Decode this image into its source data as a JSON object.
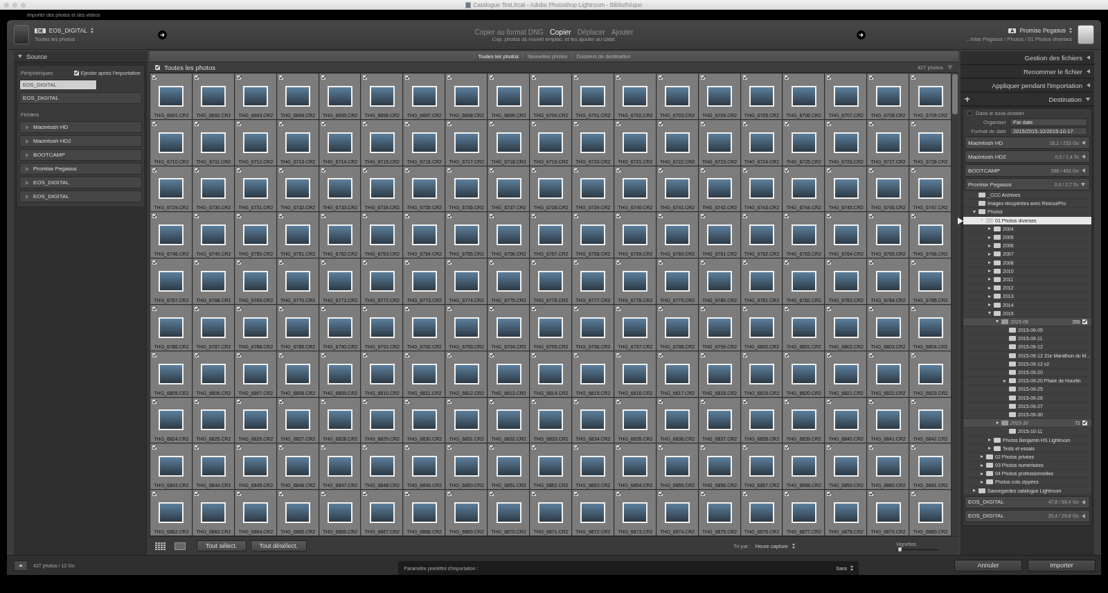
{
  "window": {
    "title": "Catalogue Test.lrcat - Adobe Photoshop Lightroom - Bibliothèque",
    "subtitle": "Importer des photos et des vidéos"
  },
  "source_header": {
    "badge": "DE",
    "device": "EOS_DIGITAL",
    "subtitle": "Toutes les photos"
  },
  "modes": [
    {
      "label": "Copier au format DNG",
      "selected": false
    },
    {
      "label": "Copier",
      "selected": true
    },
    {
      "label": "Déplacer",
      "selected": false
    },
    {
      "label": "Ajouter",
      "selected": false
    }
  ],
  "mode_description": "Cop. photos ds nouvel emplac. et les ajouter au catal.",
  "destination_header": {
    "badge": "A",
    "device": "Promise Pegasus",
    "path": "...mise Pegasus / Photos / 01 Photos diverses"
  },
  "source_panel": {
    "title": "Source",
    "expanded": true,
    "devices_label": "Périphériques",
    "eject": {
      "label": "Ejecter après l'importation",
      "checked": true
    },
    "devices": [
      {
        "name": "EOS_DIGITAL",
        "selected": true
      },
      {
        "name": "EOS_DIGITAL",
        "selected": false
      }
    ],
    "files_label": "Fichiers",
    "volumes": [
      {
        "name": "Macintosh HD",
        "expanded": false
      },
      {
        "name": "Macintosh HD2",
        "expanded": false
      },
      {
        "name": "BOOTCAMP",
        "expanded": false
      },
      {
        "name": "Promise Pegasus",
        "expanded": false
      },
      {
        "name": "EOS_DIGITAL",
        "expanded": false
      },
      {
        "name": "EOS_DIGITAL",
        "expanded": false
      }
    ]
  },
  "view_tabs": [
    {
      "label": "Toutes les photos",
      "selected": true
    },
    {
      "label": "Nouvelles photos",
      "selected": false
    },
    {
      "label": "Dossiers de destination",
      "selected": false
    }
  ],
  "grid_header": {
    "label": "Toutes les photos",
    "checked": true,
    "count": "427 photos"
  },
  "photos": [
    {
      "name": "THG_6691.CR2",
      "checked": true
    },
    {
      "name": "THG_6692.CR2",
      "checked": true
    },
    {
      "name": "THG_6693.CR2",
      "checked": true
    },
    {
      "name": "THG_6694.CR2",
      "checked": true
    },
    {
      "name": "THG_6695.CR2",
      "checked": true
    },
    {
      "name": "THG_6696.CR2",
      "checked": true
    },
    {
      "name": "THG_6697.CR2",
      "checked": true
    },
    {
      "name": "THG_6698.CR2",
      "checked": true
    },
    {
      "name": "THG_6699.CR2",
      "checked": true
    },
    {
      "name": "THG_6700.CR2",
      "checked": true
    },
    {
      "name": "THG_6701.CR2",
      "checked": true
    },
    {
      "name": "THG_6702.CR2",
      "checked": true
    },
    {
      "name": "THG_6703.CR2",
      "checked": true
    },
    {
      "name": "THG_6704.CR2",
      "checked": true
    },
    {
      "name": "THG_6705.CR2",
      "checked": true
    },
    {
      "name": "THG_6706.CR2",
      "checked": true
    },
    {
      "name": "THG_6707.CR2",
      "checked": true
    },
    {
      "name": "THG_6708.CR2",
      "checked": true
    },
    {
      "name": "THG_6709.CR2",
      "checked": true
    },
    {
      "name": "THG_6710.CR2",
      "checked": true
    },
    {
      "name": "THG_6711.CR2",
      "checked": true
    },
    {
      "name": "THG_6712.CR2",
      "checked": true
    },
    {
      "name": "THG_6713.CR2",
      "checked": true
    },
    {
      "name": "THG_6714.CR2",
      "checked": true
    },
    {
      "name": "THG_6715.CR2",
      "checked": true
    },
    {
      "name": "THG_6716.CR2",
      "checked": true
    },
    {
      "name": "THG_6717.CR2",
      "checked": true
    },
    {
      "name": "THG_6718.CR2",
      "checked": true
    },
    {
      "name": "THG_6719.CR2",
      "checked": true
    },
    {
      "name": "THG_6720.CR2",
      "checked": true
    },
    {
      "name": "THG_6721.CR2",
      "checked": true
    },
    {
      "name": "THG_6722.CR2",
      "checked": true
    },
    {
      "name": "THG_6723.CR2",
      "checked": true
    },
    {
      "name": "THG_6724.CR2",
      "checked": true
    },
    {
      "name": "THG_6725.CR2",
      "checked": true
    },
    {
      "name": "THG_6726.CR2",
      "checked": true
    },
    {
      "name": "THG_6727.CR2",
      "checked": true
    },
    {
      "name": "THG_6728.CR2",
      "checked": true
    },
    {
      "name": "THG_6729.CR2",
      "checked": true
    },
    {
      "name": "THG_6730.CR2",
      "checked": true
    },
    {
      "name": "THG_6731.CR2",
      "checked": true
    },
    {
      "name": "THG_6732.CR2",
      "checked": true
    },
    {
      "name": "THG_6733.CR2",
      "checked": true
    },
    {
      "name": "THG_6734.CR2",
      "checked": true
    },
    {
      "name": "THG_6735.CR2",
      "checked": true
    },
    {
      "name": "THG_6736.CR2",
      "checked": true
    },
    {
      "name": "THG_6737.CR2",
      "checked": true
    },
    {
      "name": "THG_6738.CR2",
      "checked": true
    },
    {
      "name": "THG_6739.CR2",
      "checked": true
    },
    {
      "name": "THG_6740.CR2",
      "checked": true
    },
    {
      "name": "THG_6741.CR2",
      "checked": true
    },
    {
      "name": "THG_6742.CR2",
      "checked": true
    },
    {
      "name": "THG_6743.CR2",
      "checked": true
    },
    {
      "name": "THG_6744.CR2",
      "checked": true
    },
    {
      "name": "THG_6745.CR2",
      "checked": true
    },
    {
      "name": "THG_6746.CR2",
      "checked": true
    },
    {
      "name": "THG_6747.CR2",
      "checked": true
    },
    {
      "name": "THG_6748.CR2",
      "checked": true
    },
    {
      "name": "THG_6749.CR2",
      "checked": true
    },
    {
      "name": "THG_6750.CR2",
      "checked": true
    },
    {
      "name": "THG_6751.CR2",
      "checked": true
    },
    {
      "name": "THG_6752.CR2",
      "checked": true
    },
    {
      "name": "THG_6753.CR2",
      "checked": true
    },
    {
      "name": "THG_6754.CR2",
      "checked": true
    },
    {
      "name": "THG_6755.CR2",
      "checked": true
    },
    {
      "name": "THG_6756.CR2",
      "checked": true
    },
    {
      "name": "THG_6757.CR2",
      "checked": true
    },
    {
      "name": "THG_6758.CR2",
      "checked": true
    },
    {
      "name": "THG_6759.CR2",
      "checked": true
    },
    {
      "name": "THG_6760.CR2",
      "checked": true
    },
    {
      "name": "THG_6761.CR2",
      "checked": true
    },
    {
      "name": "THG_6762.CR2",
      "checked": true
    },
    {
      "name": "THG_6763.CR2",
      "checked": true
    },
    {
      "name": "THG_6764.CR2",
      "checked": true
    },
    {
      "name": "THG_6765.CR2",
      "checked": true
    },
    {
      "name": "THG_6766.CR2",
      "checked": true
    },
    {
      "name": "THG_6767.CR2",
      "checked": true
    },
    {
      "name": "THG_6768.CR2",
      "checked": true
    },
    {
      "name": "THG_6769.CR2",
      "checked": true
    },
    {
      "name": "THG_6770.CR2",
      "checked": true
    },
    {
      "name": "THG_6771.CR2",
      "checked": true
    },
    {
      "name": "THG_6772.CR2",
      "checked": true
    },
    {
      "name": "THG_6773.CR2",
      "checked": true
    },
    {
      "name": "THG_6774.CR2",
      "checked": true
    },
    {
      "name": "THG_6775.CR2",
      "checked": true
    },
    {
      "name": "THG_6776.CR2",
      "checked": true
    },
    {
      "name": "THG_6777.CR2",
      "checked": true
    },
    {
      "name": "THG_6778.CR2",
      "checked": true
    },
    {
      "name": "THG_6779.CR2",
      "checked": true
    },
    {
      "name": "THG_6780.CR2",
      "checked": true
    },
    {
      "name": "THG_6781.CR2",
      "checked": true
    },
    {
      "name": "THG_6782.CR2",
      "checked": true
    },
    {
      "name": "THG_6783.CR2",
      "checked": true
    },
    {
      "name": "THG_6784.CR2",
      "checked": true
    },
    {
      "name": "THG_6785.CR2",
      "checked": true
    },
    {
      "name": "THG_6786.CR2",
      "checked": true
    },
    {
      "name": "THG_6787.CR2",
      "checked": true
    },
    {
      "name": "THG_6788.CR2",
      "checked": true
    },
    {
      "name": "THG_6789.CR2",
      "checked": true
    },
    {
      "name": "THG_6790.CR2",
      "checked": true
    },
    {
      "name": "THG_6791.CR2",
      "checked": true
    },
    {
      "name": "THG_6792.CR2",
      "checked": true
    },
    {
      "name": "THG_6793.CR2",
      "checked": true
    },
    {
      "name": "THG_6794.CR2",
      "checked": true
    },
    {
      "name": "THG_6795.CR2",
      "checked": true
    },
    {
      "name": "THG_6796.CR2",
      "checked": true
    },
    {
      "name": "THG_6797.CR2",
      "checked": true
    },
    {
      "name": "THG_6798.CR2",
      "checked": true
    },
    {
      "name": "THG_6799.CR2",
      "checked": true
    },
    {
      "name": "THG_6800.CR2",
      "checked": true
    },
    {
      "name": "THG_6801.CR2",
      "checked": true
    },
    {
      "name": "THG_6802.CR2",
      "checked": true
    },
    {
      "name": "THG_6803.CR2",
      "checked": true
    },
    {
      "name": "THG_6804.CR2",
      "checked": true
    },
    {
      "name": "THG_6805.CR2",
      "checked": true
    },
    {
      "name": "THG_6806.CR2",
      "checked": true
    },
    {
      "name": "THG_6807.CR2",
      "checked": true
    },
    {
      "name": "THG_6808.CR2",
      "checked": true
    },
    {
      "name": "THG_6809.CR2",
      "checked": true
    },
    {
      "name": "THG_6810.CR2",
      "checked": true
    },
    {
      "name": "THG_6811.CR2",
      "checked": true
    },
    {
      "name": "THG_6812.CR2",
      "checked": true
    },
    {
      "name": "THG_6813.CR2",
      "checked": true
    },
    {
      "name": "THG_6814.CR2",
      "checked": true
    },
    {
      "name": "THG_6815.CR2",
      "checked": true
    },
    {
      "name": "THG_6816.CR2",
      "checked": true
    },
    {
      "name": "THG_6817.CR2",
      "checked": true
    },
    {
      "name": "THG_6818.CR2",
      "checked": true
    },
    {
      "name": "THG_6819.CR2",
      "checked": true
    },
    {
      "name": "THG_6820.CR2",
      "checked": true
    },
    {
      "name": "THG_6821.CR2",
      "checked": true
    },
    {
      "name": "THG_6822.CR2",
      "checked": true
    },
    {
      "name": "THG_6823.CR2",
      "checked": true
    },
    {
      "name": "THG_6824.CR2",
      "checked": true
    },
    {
      "name": "THG_6825.CR2",
      "checked": true
    },
    {
      "name": "THG_6826.CR2",
      "checked": true
    },
    {
      "name": "THG_6827.CR2",
      "checked": true
    },
    {
      "name": "THG_6828.CR2",
      "checked": true
    },
    {
      "name": "THG_6829.CR2",
      "checked": true
    },
    {
      "name": "THG_6830.CR2",
      "checked": true
    },
    {
      "name": "THG_6831.CR2",
      "checked": true
    },
    {
      "name": "THG_6832.CR2",
      "checked": true
    },
    {
      "name": "THG_6833.CR2",
      "checked": true
    },
    {
      "name": "THG_6834.CR2",
      "checked": true
    },
    {
      "name": "THG_6835.CR2",
      "checked": true
    },
    {
      "name": "THG_6836.CR2",
      "checked": true
    },
    {
      "name": "THG_6837.CR2",
      "checked": true
    },
    {
      "name": "THG_6838.CR2",
      "checked": true
    },
    {
      "name": "THG_6839.CR2",
      "checked": true
    },
    {
      "name": "THG_6840.CR2",
      "checked": true
    },
    {
      "name": "THG_6841.CR2",
      "checked": true
    },
    {
      "name": "THG_6842.CR2",
      "checked": true
    },
    {
      "name": "THG_6843.CR2",
      "checked": true
    },
    {
      "name": "THG_6844.CR2",
      "checked": true
    },
    {
      "name": "THG_6845.CR2",
      "checked": true
    },
    {
      "name": "THG_6846.CR2",
      "checked": true
    },
    {
      "name": "THG_6847.CR2",
      "checked": true
    },
    {
      "name": "THG_6848.CR2",
      "checked": true
    },
    {
      "name": "THG_6849.CR2",
      "checked": true
    },
    {
      "name": "THG_6850.CR2",
      "checked": true
    },
    {
      "name": "THG_6851.CR2",
      "checked": true
    },
    {
      "name": "THG_6852.CR2",
      "checked": true
    },
    {
      "name": "THG_6853.CR2",
      "checked": true
    },
    {
      "name": "THG_6854.CR2",
      "checked": true
    },
    {
      "name": "THG_6855.CR2",
      "checked": true
    },
    {
      "name": "THG_6856.CR2",
      "checked": true
    },
    {
      "name": "THG_6857.CR2",
      "checked": true
    },
    {
      "name": "THG_6858.CR2",
      "checked": true
    },
    {
      "name": "THG_6859.CR2",
      "checked": true
    },
    {
      "name": "THG_6860.CR2",
      "checked": true
    },
    {
      "name": "THG_6861.CR2",
      "checked": true
    },
    {
      "name": "THG_6862.CR2",
      "checked": true
    },
    {
      "name": "THG_6863.CR2",
      "checked": true
    },
    {
      "name": "THG_6864.CR2",
      "checked": true
    },
    {
      "name": "THG_6865.CR2",
      "checked": true
    },
    {
      "name": "THG_6866.CR2",
      "checked": true
    },
    {
      "name": "THG_6867.CR2",
      "checked": true
    },
    {
      "name": "THG_6868.CR2",
      "checked": true
    },
    {
      "name": "THG_6869.CR2",
      "checked": true
    },
    {
      "name": "THG_6870.CR2",
      "checked": true
    },
    {
      "name": "THG_6871.CR2",
      "checked": true
    },
    {
      "name": "THG_6872.CR2",
      "checked": true
    },
    {
      "name": "THG_6873.CR2",
      "checked": true
    },
    {
      "name": "THG_6874.CR2",
      "checked": true
    },
    {
      "name": "THG_6875.CR2",
      "checked": true
    },
    {
      "name": "THG_6876.CR2",
      "checked": true
    },
    {
      "name": "THG_6877.CR2",
      "checked": true
    },
    {
      "name": "THG_6878.CR2",
      "checked": true
    },
    {
      "name": "THG_6879.CR2",
      "checked": true
    },
    {
      "name": "THG_6880.CR2",
      "checked": true
    }
  ],
  "grid_toolbar": {
    "select_all": "Tout sélect.",
    "deselect_all": "Tout désélect.",
    "sort_label": "Tri par :",
    "sort_value": "Heure capture",
    "thumbs_label": "Vignettes",
    "thumbs_slider": {
      "level": 0.05
    }
  },
  "right_sections": [
    {
      "title": "Gestion des fichiers",
      "expanded": false
    },
    {
      "title": "Renommer le fichier",
      "expanded": false
    },
    {
      "title": "Appliquer pendant l'importation",
      "expanded": false
    },
    {
      "title": "Destination",
      "expanded": true
    }
  ],
  "destination": {
    "subfolder": {
      "label": "Dans le sous-dossier",
      "checked": false
    },
    "organize_label": "Organiser",
    "organize_value": "Par date",
    "date_label": "Format de date",
    "date_value": "2015/2015-10/2015-10-17",
    "volumes": [
      {
        "name": "Macintosh HD",
        "space": "16,2 / 233 Go",
        "expanded": false
      },
      {
        "name": "Macintosh HD2",
        "space": "0,9 / 1,4 To",
        "expanded": false
      },
      {
        "name": "BOOTCAMP",
        "space": "398 / 463 Go",
        "expanded": false
      },
      {
        "name": "Promise Pegasus",
        "space": "0,9 / 2,7 To",
        "expanded": true,
        "children": [
          {
            "name": "_CCC Archives",
            "selected": false
          },
          {
            "name": "Images récupérées avec RescuePro",
            "selected": false
          },
          {
            "name": "Photos",
            "expanded": true,
            "arrow": true,
            "selected": false,
            "children": [
              {
                "name": "01 Photos diverses",
                "expanded": true,
                "arrow": true,
                "selected": true,
                "children": [
                  {
                    "name": "2004",
                    "expanded": false,
                    "arrow": true,
                    "selected": false
                  },
                  {
                    "name": "2005",
                    "expanded": false,
                    "arrow": true,
                    "selected": false
                  },
                  {
                    "name": "2006",
                    "expanded": false,
                    "arrow": true,
                    "selected": false
                  },
                  {
                    "name": "2007",
                    "expanded": false,
                    "arrow": true,
                    "selected": false
                  },
                  {
                    "name": "2008",
                    "expanded": false,
                    "arrow": true,
                    "selected": false
                  },
                  {
                    "name": "2010",
                    "expanded": false,
                    "arrow": true,
                    "selected": false
                  },
                  {
                    "name": "2011",
                    "expanded": false,
                    "arrow": true,
                    "selected": false
                  },
                  {
                    "name": "2012",
                    "expanded": false,
                    "arrow": true,
                    "selected": false
                  },
                  {
                    "name": "2013",
                    "expanded": false,
                    "arrow": true,
                    "selected": false
                  },
                  {
                    "name": "2014",
                    "expanded": false,
                    "arrow": true,
                    "selected": false
                  },
                  {
                    "name": "2015",
                    "expanded": true,
                    "arrow": true,
                    "selected": false,
                    "children": [
                      {
                        "name": "2015-09",
                        "kind": "new",
                        "count": "356",
                        "checked": true,
                        "expanded": true,
                        "arrow": true,
                        "selected": false,
                        "children": [
                          {
                            "name": "2015-09-05",
                            "selected": false
                          },
                          {
                            "name": "2015-09-11",
                            "selected": false
                          },
                          {
                            "name": "2015-09-12",
                            "selected": false
                          },
                          {
                            "name": "2015-09-12 31e Marathon du M...",
                            "selected": false
                          },
                          {
                            "name": "2015-09-12 v2",
                            "selected": false
                          },
                          {
                            "name": "2015-09-20",
                            "selected": false
                          },
                          {
                            "name": "2015-09-20 Phare de Hourtin",
                            "expanded": false,
                            "selected": false
                          },
                          {
                            "name": "2015-09-25",
                            "selected": false
                          },
                          {
                            "name": "2015-09-26",
                            "selected": false
                          },
                          {
                            "name": "2015-09-27",
                            "selected": false
                          },
                          {
                            "name": "2015-09-30",
                            "selected": false
                          }
                        ]
                      },
                      {
                        "name": "2015-10",
                        "kind": "new",
                        "count": "71",
                        "checked": true,
                        "expanded": true,
                        "arrow": true,
                        "selected": false,
                        "children": [
                          {
                            "name": "2015-10-11",
                            "selected": false
                          }
                        ]
                      }
                    ]
                  },
                  {
                    "name": "Photos Benjamin HS Lightroom",
                    "expanded": false,
                    "arrow": true,
                    "selected": false
                  },
                  {
                    "name": "Tests et essais",
                    "expanded": false,
                    "arrow": true,
                    "selected": false
                  }
                ]
              },
              {
                "name": "02 Photos privées",
                "expanded": false,
                "arrow": true,
                "selected": false
              },
              {
                "name": "03 Photos numérisées",
                "expanded": false,
                "arrow": true,
                "selected": false
              },
              {
                "name": "04 Photos professionnelles",
                "expanded": false,
                "arrow": true,
                "selected": false
              },
              {
                "name": "Photos colo zippées",
                "expanded": false,
                "arrow": true,
                "selected": false
              }
            ]
          },
          {
            "name": "Sauvegardes catalogue Lightroom",
            "expanded": false,
            "arrow": true,
            "selected": false
          }
        ]
      },
      {
        "name": "EOS_DIGITAL",
        "space": "47,8 / 59,4 Go",
        "expanded": false
      },
      {
        "name": "EOS_DIGITAL",
        "space": "20,4 / 29,8 Go",
        "expanded": false
      }
    ]
  },
  "footer": {
    "summary": "427 photos / 12 Go",
    "preset_label": "Paramètre prédéfini d'importation :",
    "preset_value": "Sans",
    "cancel": "Annuler",
    "import": "Importer"
  }
}
